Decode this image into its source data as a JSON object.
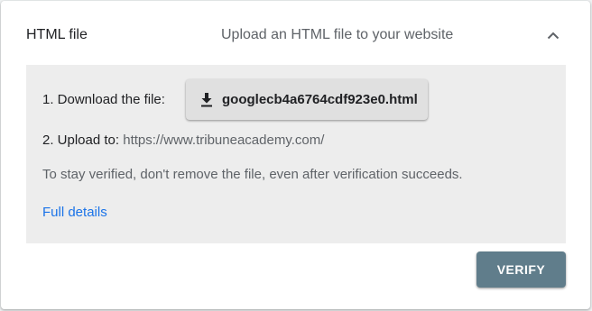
{
  "method": {
    "title": "HTML file",
    "description": "Upload an HTML file to your website",
    "collapse_icon": "chevron-up-icon"
  },
  "steps": {
    "download_label": "1. Download the file:",
    "download_icon": "download-icon",
    "download_filename": "googlecb4a6764cdf923e0.html",
    "upload_label": "2. Upload to:",
    "upload_url": "https://www.tribuneacademy.com/"
  },
  "note": "To stay verified, don't remove the file, even after verification succeeds.",
  "details_link": "Full details",
  "verify_label": "VERIFY",
  "colors": {
    "panel_bg": "#ededed",
    "link": "#1a73e8",
    "verify_bg": "#607d8b"
  }
}
